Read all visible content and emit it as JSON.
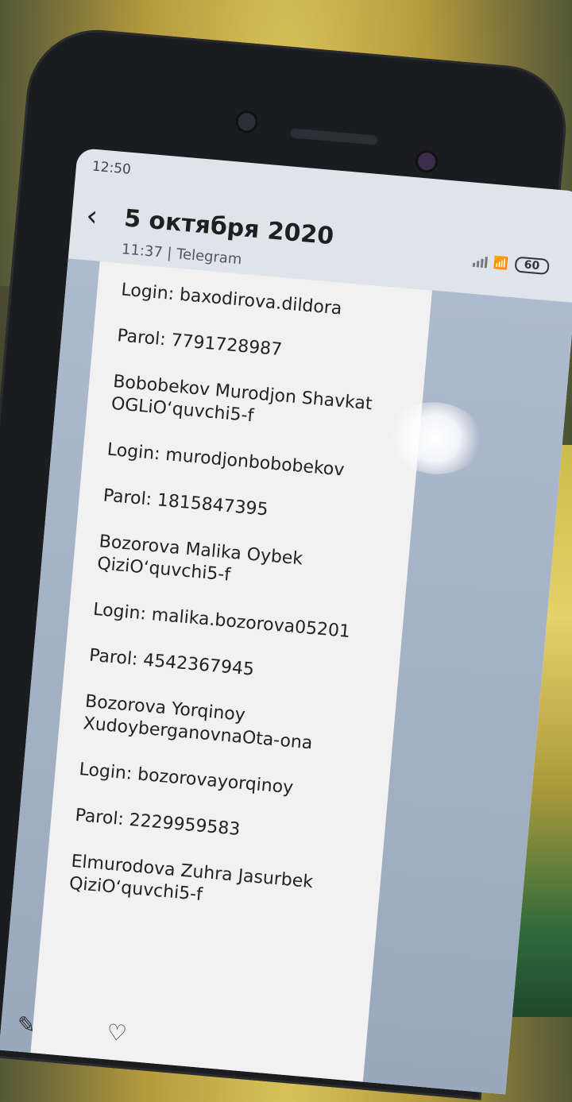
{
  "status": {
    "time": "12:50",
    "battery": "60"
  },
  "header": {
    "title": "5 октября 2020",
    "time": "11:37",
    "source": "Telegram"
  },
  "message": {
    "lines": [
      "Login: baxodirova.dildora",
      "Parol: 7791728987",
      "Bobobekov Murodjon Shavkat",
      "OGLiO‘quvchi5-f",
      "Login: murodjonbobobekov",
      "Parol: 1815847395",
      "Bozorova Malika Oybek",
      "QiziO‘quvchi5-f",
      "Login: malika.bozorova05201",
      "Parol: 4542367945",
      "Bozorova Yorqinoy",
      "XudoyberganovnaOta-ona",
      "Login: bozorovayorqinoy",
      "Parol: 2229959583",
      "Elmurodova Zuhra Jasurbek",
      "QiziO‘quvchi5-f"
    ]
  },
  "icons": {
    "back": "chevron-left-icon",
    "edit": "edit-icon",
    "favorite": "heart-icon",
    "wifi": "wifi-icon",
    "signal": "signal-icon"
  }
}
